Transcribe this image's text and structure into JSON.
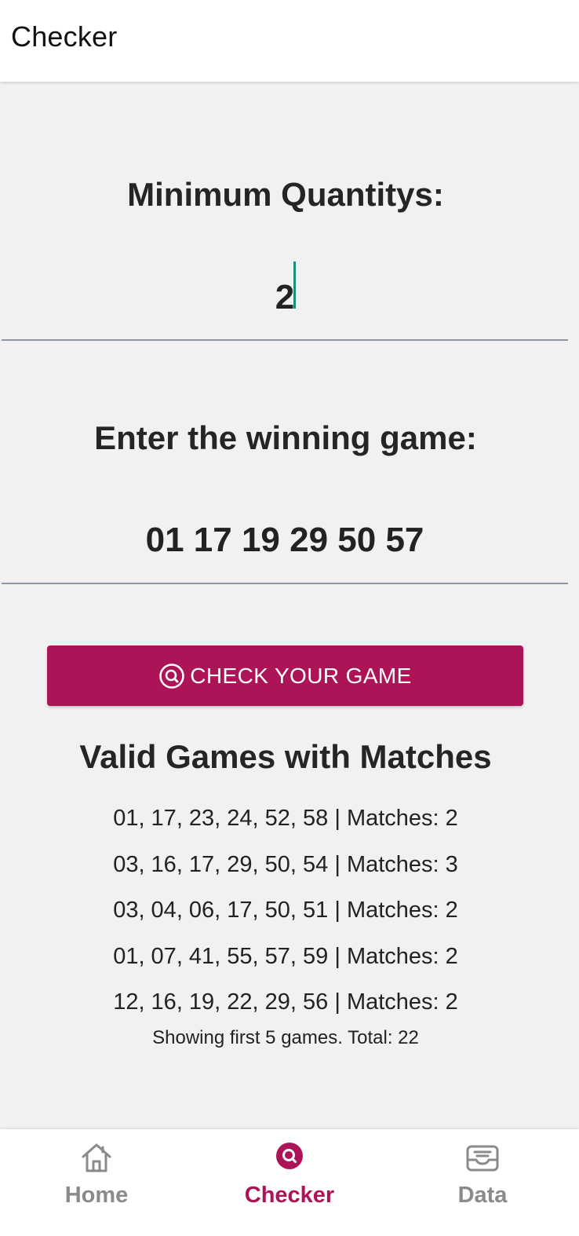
{
  "header": {
    "title": "Checker"
  },
  "form": {
    "quantity_label": "Minimum Quantitys:",
    "quantity_value": "2",
    "game_label": "Enter the winning game:",
    "game_value": "01 17 19 29 50 57"
  },
  "check_button": {
    "label": "CHECK YOUR GAME",
    "icon": "search-circle-icon"
  },
  "results": {
    "title": "Valid Games with Matches",
    "items": [
      "01, 17, 23, 24, 52, 58 | Matches: 2",
      "03, 16, 17, 29, 50, 54 | Matches: 3",
      "03, 04, 06, 17, 50, 51 | Matches: 2",
      "01, 07, 41, 55, 57, 59 | Matches: 2",
      "12, 16, 19, 22, 29, 56 | Matches: 2"
    ],
    "summary": "Showing first 5 games. Total: 22"
  },
  "bottom_nav": {
    "items": [
      {
        "label": "Home",
        "icon": "home-icon",
        "active": false
      },
      {
        "label": "Checker",
        "icon": "search-circle-icon",
        "active": true
      },
      {
        "label": "Data",
        "icon": "inbox-icon",
        "active": false
      }
    ]
  },
  "colors": {
    "accent": "#ad1457",
    "background": "#f1f1f1",
    "caret": "#1a8f7f",
    "inactive_nav": "#8a8a8a"
  }
}
